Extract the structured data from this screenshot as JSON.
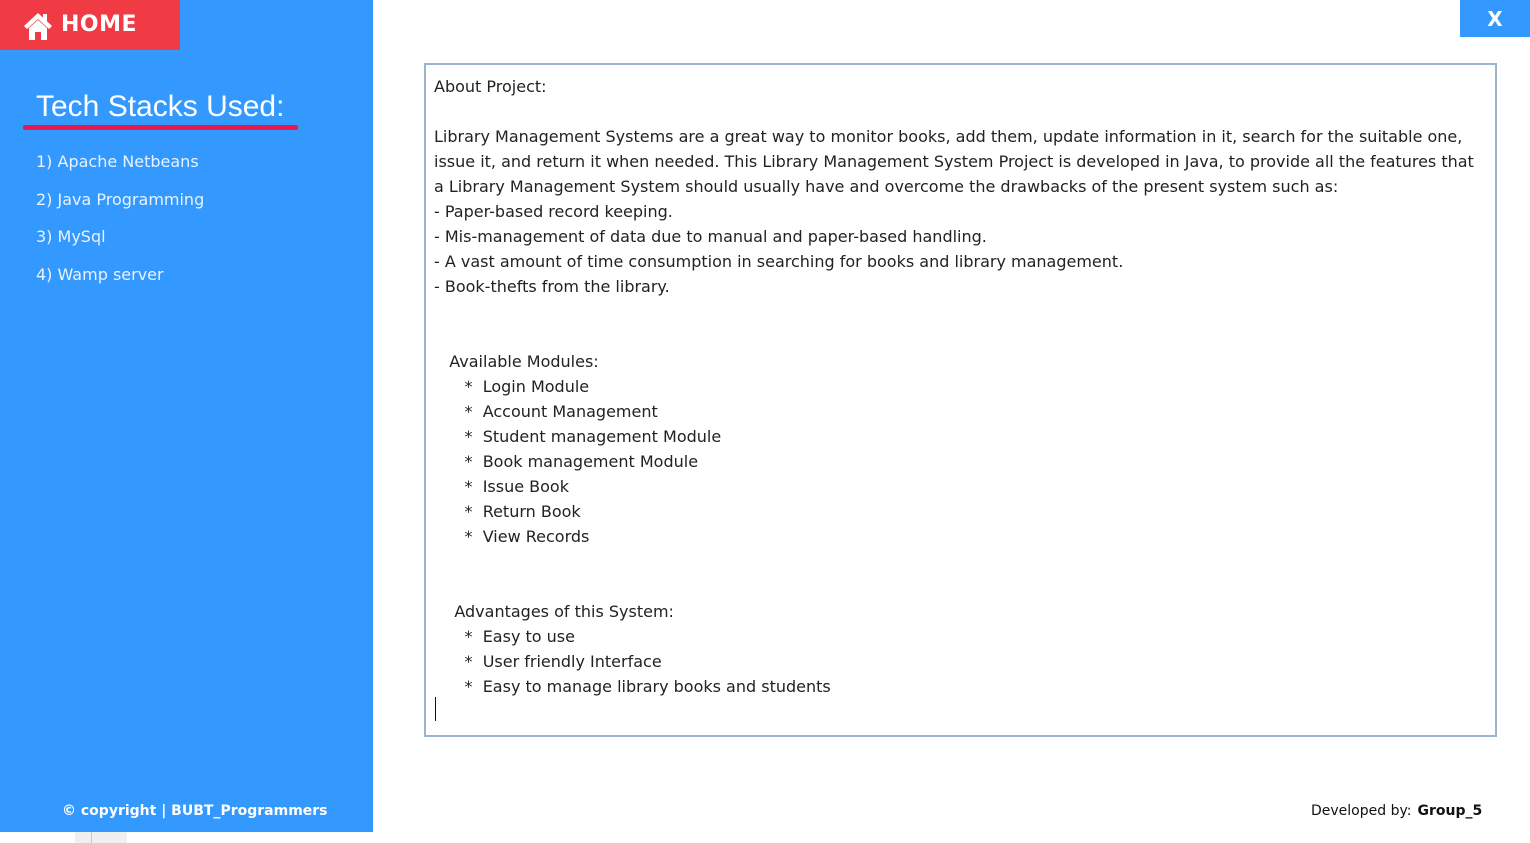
{
  "sidebar": {
    "home_label": "HOME",
    "stack_title": "Tech Stacks Used:",
    "stack_items": [
      "1) Apache Netbeans",
      "2) Java Programming",
      "3) MySql",
      "4) Wamp server"
    ],
    "copyright": "© copyright | BUBT_Programmers"
  },
  "window": {
    "close_label": "X"
  },
  "about": {
    "text": "About Project:\n\nLibrary Management Systems are a great way to monitor books, add them, update information in it, search for the suitable one, issue it, and return it when needed. This Library Management System Project is developed in Java, to provide all the features that a Library Management System should usually have and overcome the drawbacks of the present system such as:\n- Paper-based record keeping.\n- Mis-management of data due to manual and paper-based handling.\n- A vast amount of time consumption in searching for books and library management.\n- Book-thefts from the library.\n\n\n   Available Modules:\n      *  Login Module\n      *  Account Management\n      *  Student management Module\n      *  Book management Module\n      *  Issue Book\n      *  Return Book\n      *  View Records\n\n\n    Advantages of this System:\n      *  Easy to use\n      *  User friendly Interface\n      *  Easy to manage library books and students"
  },
  "footer": {
    "developed_label": "Developed by:",
    "developed_by": "Group_5"
  },
  "colors": {
    "sidebar_bg": "#3399ff",
    "home_bg": "#f03a44",
    "underline": "#e8174f",
    "box_border": "#9bb3cf"
  }
}
